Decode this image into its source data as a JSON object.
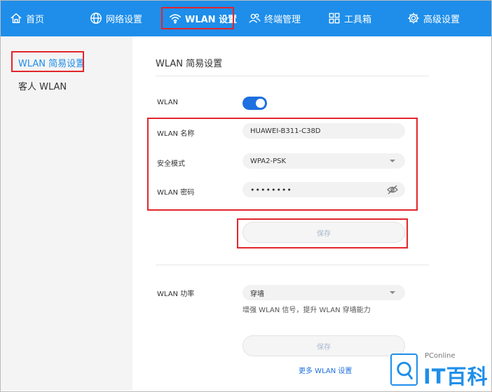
{
  "nav": {
    "items": [
      {
        "label": "首页",
        "icon": "home-icon"
      },
      {
        "label": "网络设置",
        "icon": "globe-icon"
      },
      {
        "label": "WLAN 设置",
        "icon": "wifi-icon"
      },
      {
        "label": "终端管理",
        "icon": "users-icon"
      },
      {
        "label": "工具箱",
        "icon": "grid-icon"
      },
      {
        "label": "高级设置",
        "icon": "gear-icon"
      }
    ],
    "active": "WLAN 设置",
    "bg_color": "#1e8eea"
  },
  "sidebar": {
    "items": [
      {
        "label": "WLAN 简易设置"
      },
      {
        "label": "客人 WLAN"
      }
    ],
    "active": "WLAN 简易设置"
  },
  "main": {
    "title": "WLAN 简易设置",
    "wlan_label": "WLAN",
    "wlan_enabled": true,
    "name_label": "WLAN 名称",
    "name_value": "HUAWEI-B311-C38D",
    "security_label": "安全模式",
    "security_value": "WPA2-PSK",
    "password_label": "WLAN 密码",
    "password_value": "••••••••",
    "save_label": "保存",
    "power_label": "WLAN 功率",
    "power_value": "穿墙",
    "power_hint": "增强 WLAN 信号，提升 WLAN 穿墙能力",
    "save2_label": "保存",
    "more_link": "更多 WLAN 设置"
  },
  "watermark": {
    "small": "PConline",
    "big": "IT百科"
  },
  "colors": {
    "accent": "#1e8eea",
    "toggle_on": "#1e6fe0",
    "highlight": "#e2262b"
  }
}
